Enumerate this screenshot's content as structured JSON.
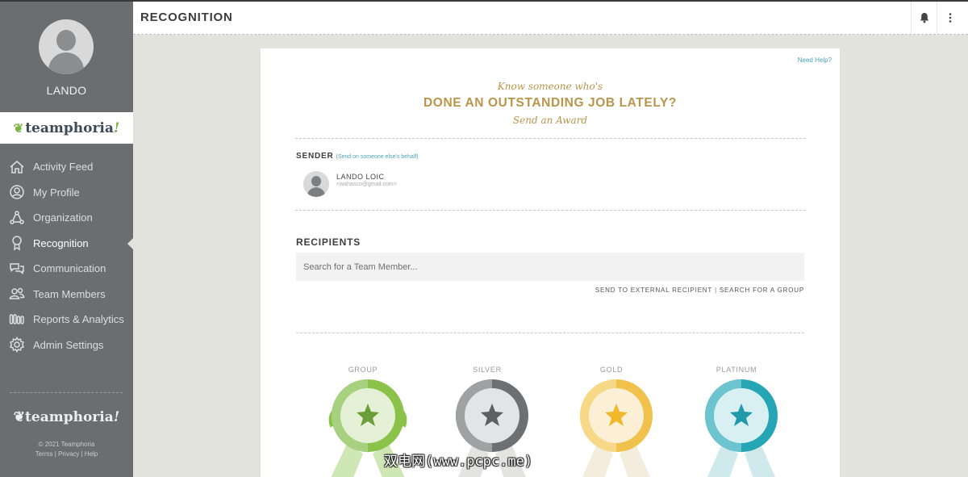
{
  "sidebar": {
    "username": "LANDO",
    "brand": {
      "name": "teamphoria",
      "bang": "!"
    },
    "items": [
      {
        "label": "Activity Feed",
        "icon": "home-icon"
      },
      {
        "label": "My Profile",
        "icon": "profile-icon"
      },
      {
        "label": "Organization",
        "icon": "organization-icon"
      },
      {
        "label": "Recognition",
        "icon": "award-icon",
        "active": true
      },
      {
        "label": "Communication",
        "icon": "chat-icon"
      },
      {
        "label": "Team Members",
        "icon": "team-icon"
      },
      {
        "label": "Reports & Analytics",
        "icon": "reports-icon"
      },
      {
        "label": "Admin Settings",
        "icon": "gear-icon"
      }
    ],
    "footer": {
      "logo": "teamphoria",
      "bang": "!",
      "copyright": "© 2021 Teamphoria",
      "links": "Terms | Privacy | Help"
    }
  },
  "header": {
    "title": "RECOGNITION"
  },
  "card": {
    "help": "Need Help?",
    "hero": {
      "line1": "Know someone who's",
      "line2": "DONE AN OUTSTANDING JOB LATELY?",
      "line3": "Send an Award"
    },
    "sender": {
      "label": "SENDER",
      "sub": "(Send on someone else's behalf)",
      "name": "LANDO LOIC",
      "email": "<wahasco@gmail.com>"
    },
    "recipients": {
      "label": "RECIPIENTS",
      "placeholder": "Search for a Team Member...",
      "external": "SEND TO EXTERNAL RECIPIENT",
      "group": "SEARCH FOR A GROUP"
    },
    "awards": [
      {
        "name": "GROUP",
        "color": "#8bc34a",
        "light": "#cfe6b5"
      },
      {
        "name": "SILVER",
        "color": "#6d7073",
        "light": "#d6d8d9"
      },
      {
        "name": "GOLD",
        "color": "#f0c14b",
        "light": "#f7e1a6"
      },
      {
        "name": "PLATINUM",
        "color": "#26a6b5",
        "light": "#a9dde3"
      }
    ]
  },
  "watermark": "双电网(www.pcpc.me)"
}
